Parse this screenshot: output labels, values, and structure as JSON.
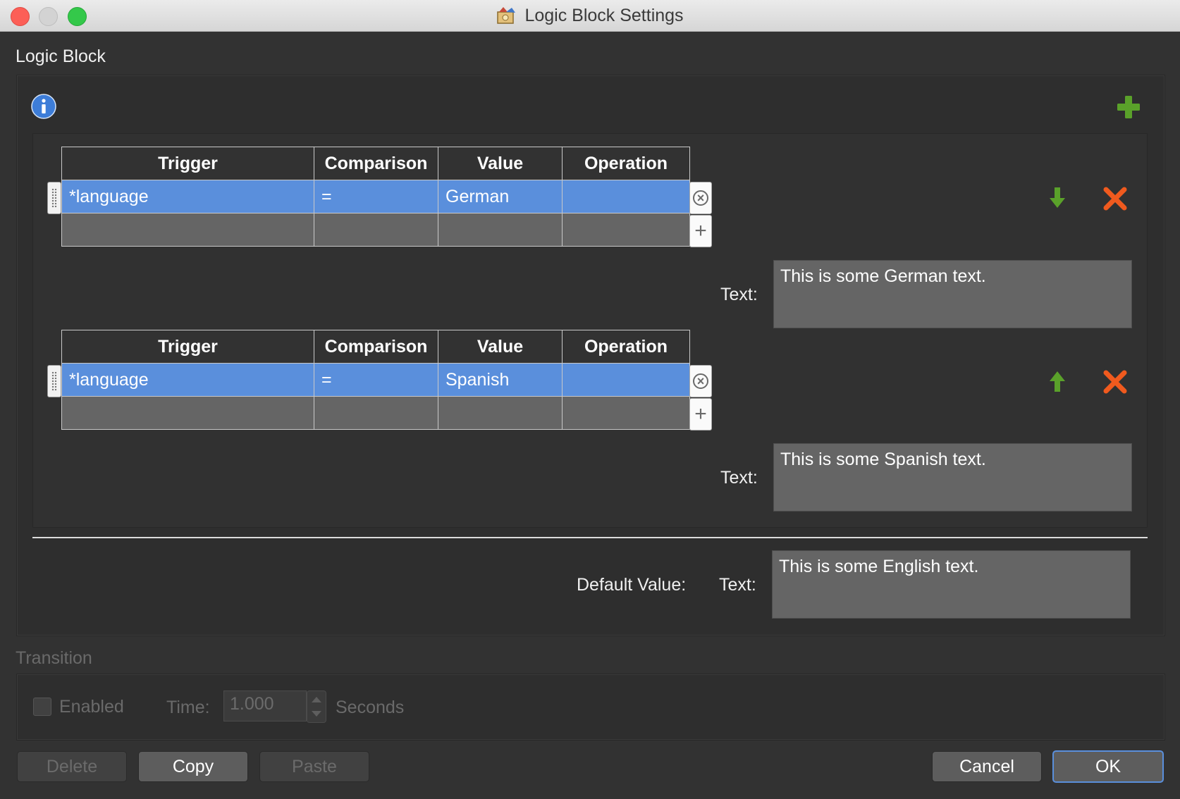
{
  "window": {
    "title": "Logic Block Settings"
  },
  "logic_block": {
    "section_title": "Logic Block",
    "columns": [
      "Trigger",
      "Comparison",
      "Value",
      "Operation"
    ],
    "conditions": [
      {
        "row": {
          "trigger": "*language",
          "comparison": "=",
          "value": "German",
          "operation": ""
        },
        "text_label": "Text:",
        "text": "This is some German text.",
        "move_icon": "arrow-down-icon"
      },
      {
        "row": {
          "trigger": "*language",
          "comparison": "=",
          "value": "Spanish",
          "operation": ""
        },
        "text_label": "Text:",
        "text": "This is some Spanish text.",
        "move_icon": "arrow-up-icon"
      }
    ],
    "default": {
      "label": "Default Value:",
      "text_label": "Text:",
      "text": "This is some English text."
    }
  },
  "transition": {
    "section_title": "Transition",
    "enabled_label": "Enabled",
    "enabled_checked": false,
    "time_label": "Time:",
    "time_value": "1.000",
    "unit_label": "Seconds"
  },
  "buttons": {
    "delete": "Delete",
    "copy": "Copy",
    "paste": "Paste",
    "cancel": "Cancel",
    "ok": "OK"
  },
  "colors": {
    "selection": "#5a8fdc",
    "add": "#5aa12a",
    "remove": "#f05a1e",
    "info": "#3d7dd8"
  }
}
